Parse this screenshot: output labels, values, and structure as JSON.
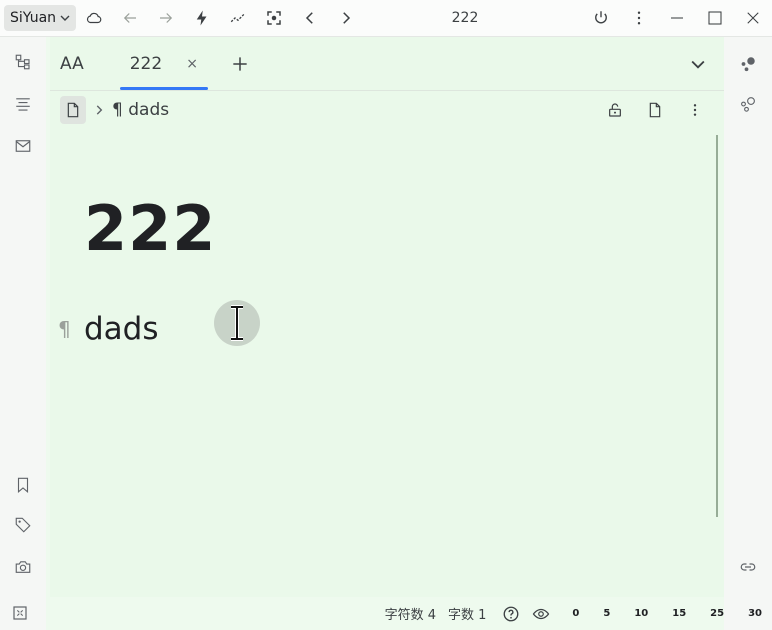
{
  "topbar": {
    "brand": "SiYuan",
    "window_title": "222"
  },
  "tabs": [
    {
      "label": "AA",
      "active": false
    },
    {
      "label": "222",
      "active": true,
      "close": "×"
    }
  ],
  "breadcrumb": {
    "mark": "¶",
    "item": "dads"
  },
  "document": {
    "title": "222",
    "paragraph_mark": "¶",
    "paragraph": "dads"
  },
  "statusbar": {
    "char_count": "字符数 4",
    "word_count": "字数 1",
    "zoom_levels": [
      "0",
      "5",
      "10",
      "15",
      "25",
      "30"
    ]
  },
  "colors": {
    "editor_bg": "#eaf9ea",
    "accent": "#3478f6"
  }
}
